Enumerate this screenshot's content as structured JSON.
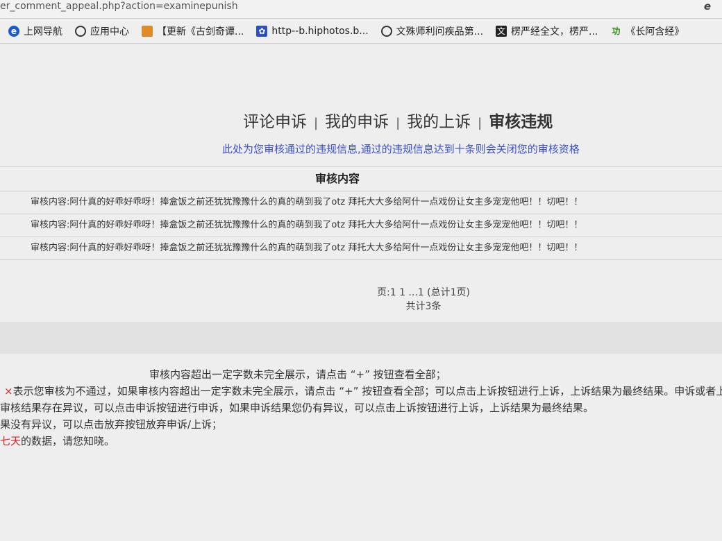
{
  "address_bar": {
    "url": "er_comment_appeal.php?action=examinepunish",
    "browser_icon": "e"
  },
  "bookmarks": [
    {
      "icon": "ie-icon",
      "label": "上网导航"
    },
    {
      "icon": "globe-icon",
      "label": "应用中心"
    },
    {
      "icon": "bowl-icon",
      "label": "【更新《古剑奇谭..."
    },
    {
      "icon": "paw-icon",
      "label": "http--b.hiphotos.b..."
    },
    {
      "icon": "globe-icon",
      "label": "文殊师利问疾品第..."
    },
    {
      "icon": "doc-icon",
      "label": "楞严经全文，楞严..."
    },
    {
      "icon": "green-icon",
      "label": "《长阿含经》"
    }
  ],
  "tabs": [
    {
      "label": "评论申诉"
    },
    {
      "label": "我的申诉"
    },
    {
      "label": "我的上诉"
    },
    {
      "label": "审核违规"
    }
  ],
  "notice": "此处为您审核通过的违规信息,通过的违规信息达到十条则会关闭您的审核资格",
  "table": {
    "header": "审核内容",
    "rows": [
      "审核内容:阿什真的好乖好乖呀！捧盒饭之前还犹犹豫豫什么的真的萌到我了otz 拜托大大多给阿什一点戏份让女主多宠宠他吧！！切吧！！",
      "审核内容:阿什真的好乖好乖呀！捧盒饭之前还犹犹豫豫什么的真的萌到我了otz 拜托大大多给阿什一点戏份让女主多宠宠他吧！！切吧！！",
      "审核内容:阿什真的好乖好乖呀！捧盒饭之前还犹犹豫豫什么的真的萌到我了otz 拜托大大多给阿什一点戏份让女主多宠宠他吧！！切吧！！"
    ]
  },
  "pager": {
    "pages": "页:1 1 ...1 (总计1页)",
    "total": "共计3条"
  },
  "notes": {
    "line1": "按钮查看全部；",
    "line1_prefix": "审核内容超出一定字数未完全展示，请点击 “+” ",
    "line2_mark": "×",
    "line2": "表示您审核为不通过，如果审核内容超出一定字数未完全展示，请点击 “+” 按钮查看全部；可以点击上诉按钮进行上诉，上诉结果为最终结果。申诉或者上诉成功",
    "line3": "审核结果存在异议，可以点击申诉按钮进行申诉，如果申诉结果您仍有异议，可以点击上诉按钮进行上诉，上诉结果为最终结果。",
    "line4": "果没有异议，可以点击放弃按钮放弃申诉/上诉；",
    "line5_red": "七天",
    "line5": "的数据，请您知晓。"
  },
  "colors": {
    "notice_blue": "#3b4fc9",
    "alert_red": "#dd2222"
  }
}
